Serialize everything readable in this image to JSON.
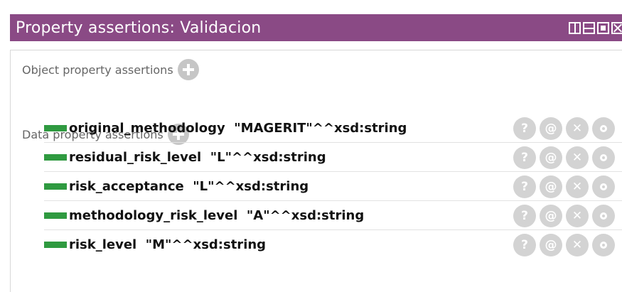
{
  "window": {
    "title": "Property assertions: Validacion",
    "accent_color": "#8a4a85"
  },
  "sections": {
    "object": {
      "label": "Object property assertions"
    },
    "data": {
      "label": "Data property assertions"
    }
  },
  "data_assertions": [
    {
      "text": "original_methodology  \"MAGERIT\"^^xsd:string"
    },
    {
      "text": "residual_risk_level  \"L\"^^xsd:string"
    },
    {
      "text": "risk_acceptance  \"L\"^^xsd:string"
    },
    {
      "text": "methodology_risk_level  \"A\"^^xsd:string"
    },
    {
      "text": "risk_level  \"M\"^^xsd:string"
    }
  ],
  "row_buttons": {
    "explain": "?",
    "annotate": "@",
    "delete": "✕",
    "edit": ""
  },
  "colors": {
    "data_property_icon": "#2f9a40",
    "button_grey": "#d3d3d3"
  }
}
